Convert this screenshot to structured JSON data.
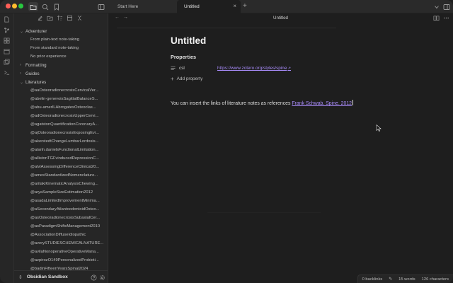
{
  "window": {
    "title": "Untitled"
  },
  "tabs": [
    {
      "label": "Start Here",
      "active": false
    },
    {
      "label": "Untitled",
      "active": true
    }
  ],
  "sidebar": {
    "folders": [
      {
        "label": "Adventurer",
        "expanded": true,
        "children": [
          "From plain-text note-taking",
          "From standard note-taking",
          "No prior experience"
        ]
      },
      {
        "label": "Formatting",
        "expanded": false
      },
      {
        "label": "Guides",
        "expanded": false
      },
      {
        "label": "Literatures",
        "expanded": true
      }
    ],
    "literature_files": [
      "@aaOsteoradionecrosisCervicalVer...",
      "@abelin-genevoisSagittalBalanceS...",
      "@abu-amerILAbrogatesOsteoclas...",
      "@adOsteoradionecrosisUpperCervi...",
      "@agatstonQuantificationCoronaryA...",
      "@ajOsteoradionecrosisExposingEvi...",
      "@akerstedtChangeLumbarLordosis...",
      "@alanh.danielsFunctionalLimitation...",
      "@allistonTGFvinducedRepressionC...",
      "@alvlAssessingDifferenceClinical20...",
      "@amesStandardizedNomenclature...",
      "@aritakiKinematicAnalysisChewing...",
      "@aryaSampleSizeEstimation2012",
      "@asadaLimitedImprovementMinima...",
      "@aSecondaryAtlantoodontoidOsteo...",
      "@asOsteoradionecrosisSubaxialCer...",
      "@asParadigmShiftsManagement2010",
      "@AssociationDiffuseIdiopathic",
      "@averySTUDIESCHEMICALNATURE...",
      "@avilaNonoperativeOperativeMana...",
      "@azpirozO149PersonalizedProbioti...",
      "@badinFifteenYearsSpinal2024"
    ],
    "vault_name": "Obsidian Sandbox"
  },
  "editor": {
    "header_title": "Untitled",
    "doc_title": "Untitled",
    "properties_heading": "Properties",
    "property": {
      "key": "csl",
      "value": "https://www.zotero.org/styles/spine"
    },
    "add_property_label": "Add property",
    "body_prefix": "You can insert the links of literature notes as references ",
    "body_link": "Frank Schwab. Spine. 2012"
  },
  "status_bar": {
    "backlinks": "0 backlinks",
    "words": "15 words",
    "characters": "126 characters"
  },
  "colors": {
    "accent": "#a88bfa",
    "background": "#1e1e1e",
    "sidebar": "#262626"
  }
}
